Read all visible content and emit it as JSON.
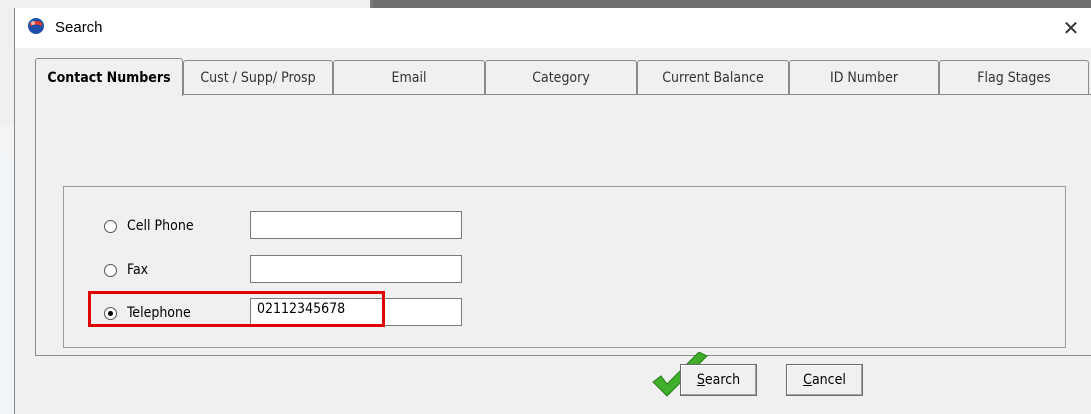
{
  "window": {
    "title": "Search",
    "close_glyph": "✕"
  },
  "tabs": [
    {
      "label": "Contact Numbers",
      "active": true
    },
    {
      "label": "Cust / Supp/ Prosp",
      "active": false
    },
    {
      "label": "Email",
      "active": false
    },
    {
      "label": "Category",
      "active": false
    },
    {
      "label": "Current Balance",
      "active": false
    },
    {
      "label": "ID Number",
      "active": false
    },
    {
      "label": "Flag Stages",
      "active": false
    }
  ],
  "form": {
    "cell_phone": {
      "label": "Cell Phone",
      "value": "",
      "selected": false
    },
    "fax": {
      "label": "Fax",
      "value": "",
      "selected": false
    },
    "telephone": {
      "label": "Telephone",
      "value": "02112345678",
      "selected": true
    }
  },
  "buttons": {
    "search": {
      "mnemonic": "S",
      "rest": "earch"
    },
    "cancel": {
      "mnemonic": "C",
      "rest": "ancel"
    }
  },
  "colors": {
    "highlight": "#e00000",
    "check": "#3fae2a"
  },
  "icons": [
    "app-globe-icon",
    "close-icon",
    "checkmark-icon"
  ]
}
